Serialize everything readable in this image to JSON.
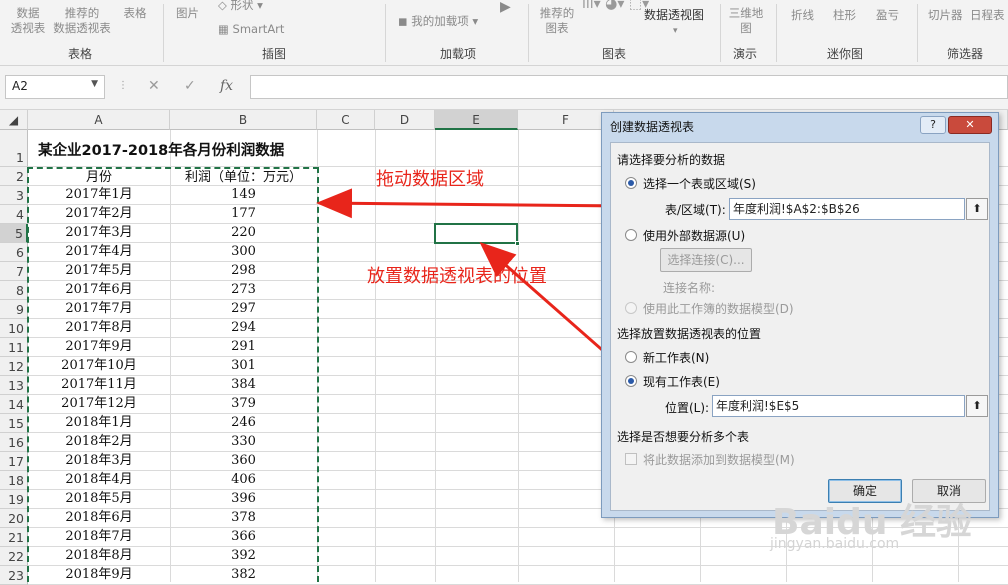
{
  "ribbon": {
    "buttons": [
      "数据\n透视表",
      "推荐的\n数据透视表",
      "表格",
      "图片",
      "形状 ▾",
      "SmartArt",
      "我的加载项 ▾",
      "推荐的\n图表",
      "数据透视图",
      "三维地\n图",
      "折线",
      "柱形",
      "盈亏",
      "切片器",
      "日程表"
    ],
    "groups": [
      "表格",
      "插图",
      "加载项",
      "图表",
      "演示",
      "迷你图",
      "筛选器"
    ]
  },
  "formula_bar": {
    "name_box": "A2",
    "cancel": "✕",
    "enter": "✓",
    "fx": "fx",
    "formula": ""
  },
  "sheet": {
    "columns": [
      "A",
      "B",
      "C",
      "D",
      "E",
      "F"
    ],
    "rows": [
      "1",
      "2",
      "3",
      "4",
      "5",
      "6",
      "7",
      "8",
      "9",
      "10",
      "11",
      "12",
      "13",
      "14",
      "15",
      "16",
      "17",
      "18",
      "19",
      "20",
      "21",
      "22",
      "23"
    ],
    "title": "某企业2017-2018年各月份利润数据",
    "header_month": "月份",
    "header_profit": "利润（单位：万元）",
    "months": [
      "2017年1月",
      "2017年2月",
      "2017年3月",
      "2017年4月",
      "2017年5月",
      "2017年6月",
      "2017年7月",
      "2017年8月",
      "2017年9月",
      "2017年10月",
      "2017年11月",
      "2017年12月",
      "2018年1月",
      "2018年2月",
      "2018年3月",
      "2018年4月",
      "2018年5月",
      "2018年6月",
      "2018年7月",
      "2018年8月",
      "2018年9月"
    ],
    "profits": [
      "149",
      "177",
      "220",
      "300",
      "298",
      "273",
      "297",
      "294",
      "291",
      "301",
      "384",
      "379",
      "246",
      "330",
      "360",
      "406",
      "396",
      "378",
      "366",
      "392",
      "382"
    ]
  },
  "annotations": {
    "drag_range": "拖动数据区域",
    "place_location": "放置数据透视表的位置"
  },
  "dialog": {
    "title": "创建数据透视表",
    "help": "?",
    "close": "✕",
    "section1": "请选择要分析的数据",
    "opt_table_range": "选择一个表或区域(S)",
    "range_label": "表/区域(T):",
    "range_value": "年度利润!$A$2:$B$26",
    "opt_external": "使用外部数据源(U)",
    "choose_conn": "选择连接(C)...",
    "conn_name": "连接名称:",
    "opt_data_model": "使用此工作簿的数据模型(D)",
    "section2": "选择放置数据透视表的位置",
    "opt_new_sheet": "新工作表(N)",
    "opt_existing": "现有工作表(E)",
    "location_label": "位置(L):",
    "location_value": "年度利润!$E$5",
    "section3": "选择是否想要分析多个表",
    "add_to_model": "将此数据添加到数据模型(M)",
    "ok": "确定",
    "cancel": "取消"
  },
  "watermark": {
    "brand": "Baidu 经验",
    "url": "jingyan.baidu.com"
  },
  "colors": {
    "excel_green": "#217346",
    "annotation_red": "#e8251b",
    "dialog_frame": "#c8d9ec"
  }
}
